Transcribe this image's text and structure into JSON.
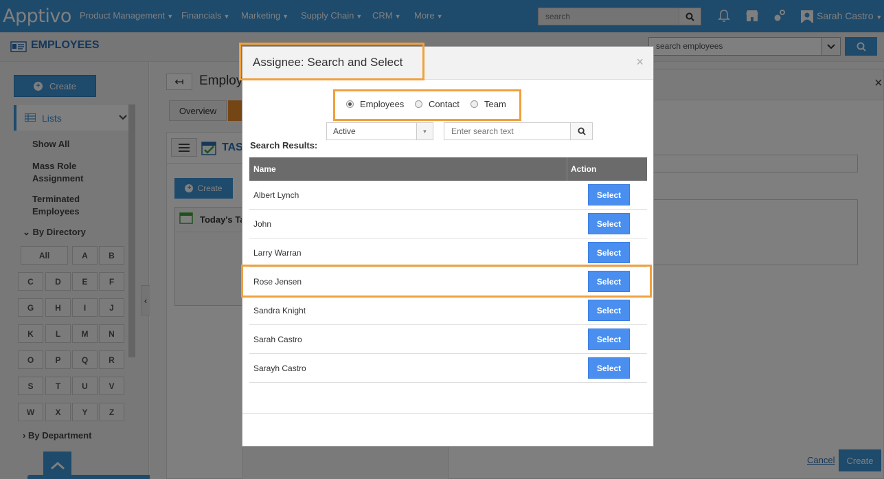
{
  "topnav": {
    "logo": "Apptivo",
    "menu": [
      {
        "label": "Product Management"
      },
      {
        "label": "Financials"
      },
      {
        "label": "Marketing"
      },
      {
        "label": "Supply Chain"
      },
      {
        "label": "CRM"
      },
      {
        "label": "More"
      }
    ],
    "search_placeholder": "search",
    "user": "Sarah Castro"
  },
  "app": {
    "title": "EMPLOYEES",
    "search_placeholder": "search employees"
  },
  "sidebar": {
    "create_label": "Create",
    "lists_label": "Lists",
    "links": [
      "Show All",
      "Mass Role Assignment",
      "Terminated Employees"
    ],
    "by_directory": "By Directory",
    "letters": [
      "All",
      "A",
      "B",
      "C",
      "D",
      "E",
      "F",
      "G",
      "H",
      "I",
      "J",
      "K",
      "L",
      "M",
      "N",
      "O",
      "P",
      "Q",
      "R",
      "S",
      "T",
      "U",
      "V",
      "W",
      "X",
      "Y",
      "Z"
    ],
    "by_department": "By Department"
  },
  "main": {
    "title": "Employ",
    "tabs": [
      "Overview"
    ],
    "panel_title": "TAS",
    "create_label": "Create",
    "todays": "Today's Ta",
    "cancel": "Cancel",
    "create": "Create"
  },
  "modal": {
    "title": "Assignee: Search and Select",
    "close": "×",
    "radios": [
      {
        "label": "Employees",
        "selected": true
      },
      {
        "label": "Contact",
        "selected": false
      },
      {
        "label": "Team",
        "selected": false
      }
    ],
    "status_value": "Active",
    "search_placeholder": "Enter search text",
    "results_label": "Search Results:",
    "columns": [
      "Name",
      "Action"
    ],
    "select_label": "Select",
    "rows": [
      "Albert Lynch",
      "John",
      "Larry Warran",
      "Rose Jensen",
      "Sandra Knight",
      "Sarah Castro",
      "Sarayh Castro"
    ],
    "highlight_color": "#f0a03c"
  }
}
